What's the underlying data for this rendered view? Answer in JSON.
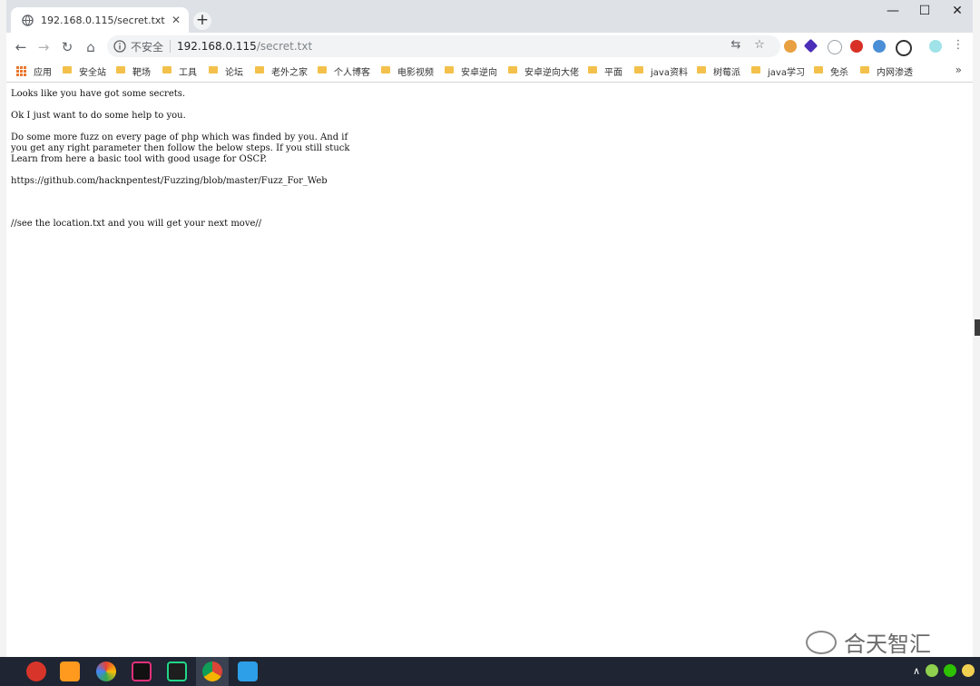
{
  "browser": {
    "tab": {
      "title": "192.168.0.115/secret.txt",
      "close": "✕"
    },
    "new_tab": "+",
    "window_controls": {
      "minimize": "—",
      "maximize": "☐",
      "close": "✕"
    },
    "nav": {
      "back": "←",
      "forward": "→",
      "reload": "↻",
      "home": "⌂"
    },
    "omnibox": {
      "security_label": "不安全",
      "host": "192.168.0.115",
      "path": "/secret.txt"
    },
    "toolbar_icons": {
      "translate": "⇆",
      "star": "☆",
      "menu": "⋮"
    }
  },
  "bookmarks": {
    "items": [
      "应用",
      "安全站",
      "靶场",
      "工具",
      "论坛",
      "老外之家",
      "个人博客",
      "电影视频",
      "安卓逆向",
      "安卓逆向大佬",
      "平面",
      "java资料",
      "树莓派",
      "java学习",
      "免杀",
      "内网渗透"
    ],
    "more": "»"
  },
  "page": {
    "lines": [
      "Looks like you have got some secrets.",
      "",
      "Ok I just want to do some help to you.",
      "",
      "Do some more fuzz on every page of php which was finded by you. And if",
      "you get any right parameter then follow the below steps. If you still stuck",
      "Learn from here a basic tool with good usage for OSCP.",
      "",
      "https://github.com/hacknpentest/Fuzzing/blob/master/Fuzz_For_Web",
      "",
      "",
      "",
      "//see the location.txt and you will get your next move//"
    ]
  },
  "watermark": {
    "text": "合天智汇"
  },
  "colors": {
    "tabstrip": "#dee1e6",
    "omnibox": "#f1f3f4",
    "folder": "#f3c14b",
    "taskbar": "#1f2532"
  },
  "taskbar": {
    "apps": [
      "snail-app-icon",
      "sublime-text-icon",
      "browser-app-icon",
      "intellij-idea-icon",
      "pycharm-icon",
      "chrome-icon",
      "wps-writer-icon"
    ]
  }
}
